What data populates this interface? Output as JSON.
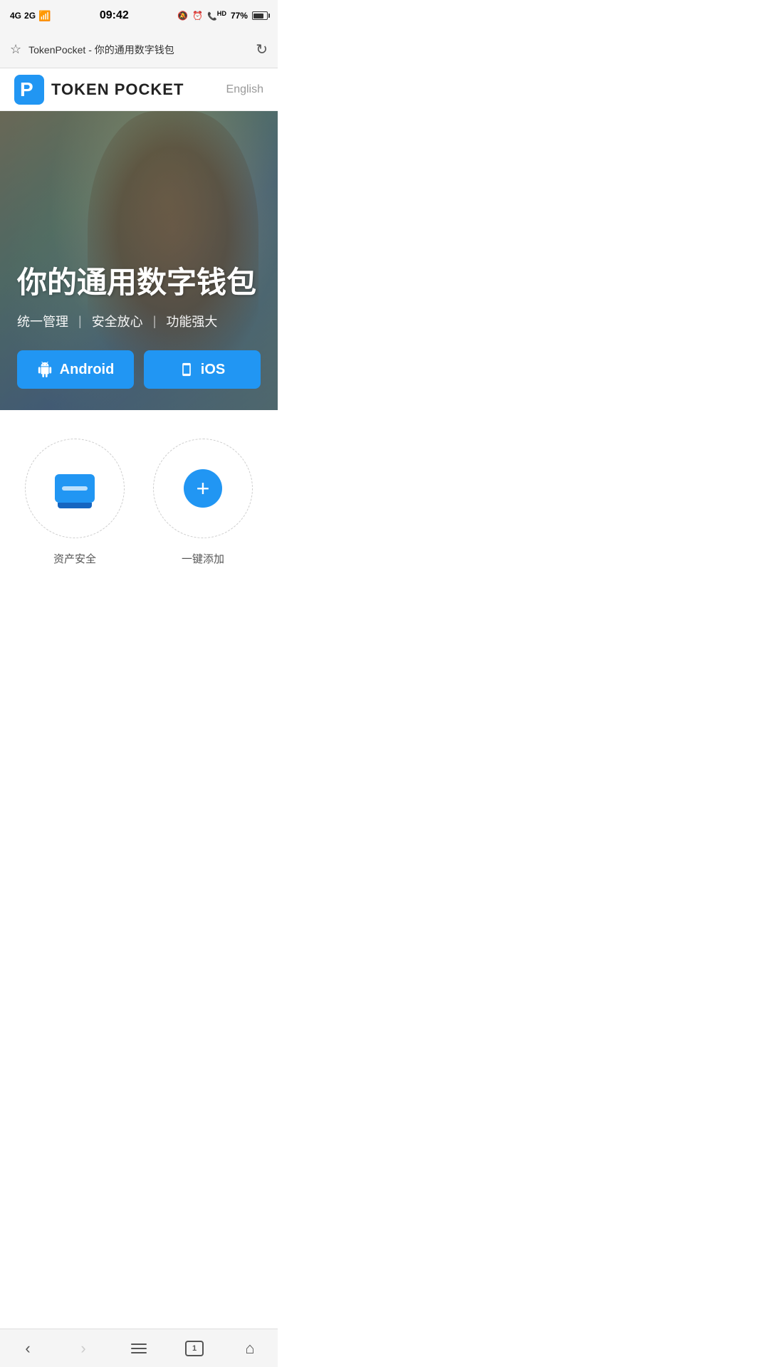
{
  "statusBar": {
    "time": "09:42",
    "battery": "77%",
    "signal": "4G",
    "signal2": "2G"
  },
  "browserBar": {
    "url": "TokenPocket - 你的通用数字钱包",
    "star": "☆",
    "refresh": "↻"
  },
  "navbar": {
    "logoText": "TOKEN POCKET",
    "langLabel": "English"
  },
  "hero": {
    "title": "你的通用数字钱包",
    "subtitle1": "统一管理",
    "subtitle2": "安全放心",
    "subtitle3": "功能强大",
    "androidBtn": "Android",
    "iosBtn": "iOS"
  },
  "features": [
    {
      "type": "wallet",
      "label": "资产安全"
    },
    {
      "type": "plus",
      "label": "一键添加"
    }
  ],
  "bottomNav": {
    "back": "‹",
    "forward": "›",
    "tabCount": "1"
  }
}
